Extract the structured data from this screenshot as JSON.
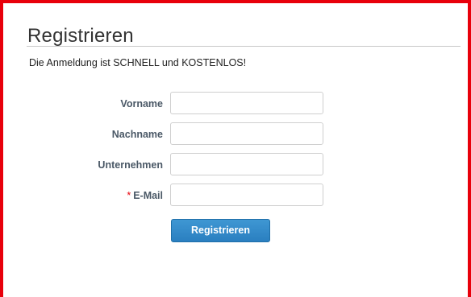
{
  "form": {
    "title": "Registrieren",
    "subtitle": "Die Anmeldung ist SCHNELL und KOSTENLOS!",
    "fields": [
      {
        "label": "Vorname",
        "value": "",
        "required": false
      },
      {
        "label": "Nachname",
        "value": "",
        "required": false
      },
      {
        "label": "Unternehmen",
        "value": "",
        "required": false
      },
      {
        "label": "E-Mail",
        "value": "",
        "required": true,
        "required_marker": "*"
      }
    ],
    "submit_label": "Registrieren"
  },
  "colors": {
    "frame_border": "#e8000b",
    "button": "#2a7fc0",
    "label": "#4a5866",
    "required_marker": "#e8000b"
  }
}
